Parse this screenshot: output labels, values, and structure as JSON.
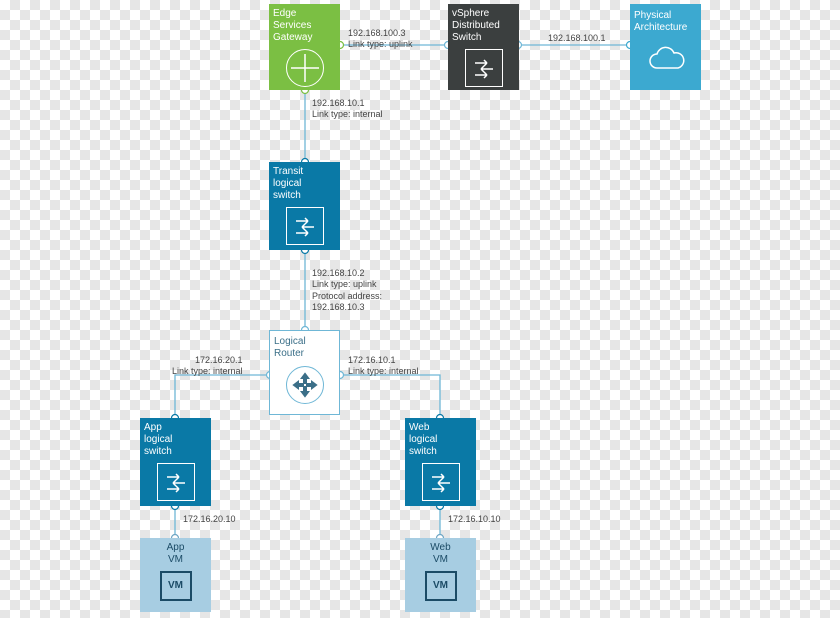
{
  "nodes": {
    "esg": {
      "l1": "Edge",
      "l2": "Services",
      "l3": "Gateway"
    },
    "vds": {
      "l1": "vSphere",
      "l2": "Distributed",
      "l3": "Switch"
    },
    "phys": {
      "l1": "Physical",
      "l2": "Architecture"
    },
    "transit": {
      "l1": "Transit",
      "l2": "logical",
      "l3": "switch"
    },
    "router": {
      "l1": "Logical",
      "l2": "Router"
    },
    "appsw": {
      "l1": "App",
      "l2": "logical",
      "l3": "switch"
    },
    "websw": {
      "l1": "Web",
      "l2": "logical",
      "l3": "switch"
    },
    "appvm": {
      "l1": "App",
      "l2": "VM",
      "icon": "VM"
    },
    "webvm": {
      "l1": "Web",
      "l2": "VM",
      "icon": "VM"
    }
  },
  "labels": {
    "esg_vds": {
      "ip": "192.168.100.3",
      "type": "Link type: uplink"
    },
    "vds_phys": {
      "ip": "192.168.100.1"
    },
    "esg_transit": {
      "ip": "192.168.10.1",
      "type": "Link type: internal"
    },
    "transit_router": {
      "ip": "192.168.10.2",
      "type": "Link type: uplink",
      "proto1": "Protocol address:",
      "proto2": "192.168.10.3"
    },
    "router_app": {
      "ip": "172.16.20.1",
      "type": "Link type: internal"
    },
    "router_web": {
      "ip": "172.16.10.1",
      "type": "Link type: internal"
    },
    "app_vm": {
      "ip": "172.16.20.10"
    },
    "web_vm": {
      "ip": "172.16.10.10"
    }
  },
  "colors": {
    "green": "#7bbf43",
    "dark": "#3b3f3f",
    "blue": "#3ca9d0",
    "teal": "#0a79a6",
    "light": "#a7cde2",
    "line": "#6fb7d6"
  }
}
